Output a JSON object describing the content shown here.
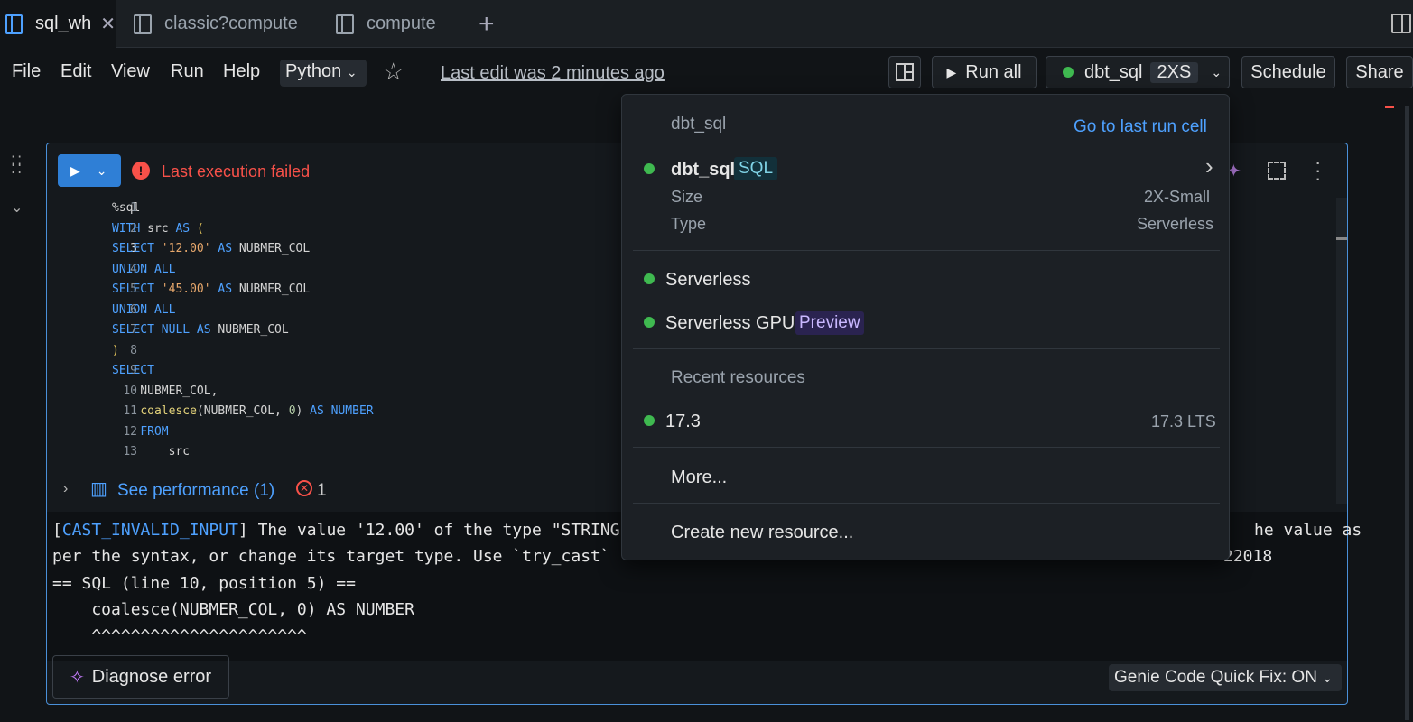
{
  "tabs": [
    {
      "label": "sql_wh",
      "active": true
    },
    {
      "label": "classic?compute",
      "active": false
    },
    {
      "label": "compute",
      "active": false
    }
  ],
  "menu": {
    "file": "File",
    "edit": "Edit",
    "view": "View",
    "run": "Run",
    "help": "Help",
    "language": "Python",
    "last_edit": "Last edit was 2 minutes ago"
  },
  "toolbar": {
    "run_all": "Run all",
    "compute_name": "dbt_sql",
    "compute_size": "2XS",
    "schedule": "Schedule",
    "share": "Share"
  },
  "cell": {
    "status": "Last execution failed",
    "code_lines": [
      {
        "n": "1",
        "text": "%sql"
      },
      {
        "n": "2",
        "text": "WITH src AS ("
      },
      {
        "n": "3",
        "text": "SELECT '12.00' AS NUBMER_COL"
      },
      {
        "n": "4",
        "text": "UNION ALL"
      },
      {
        "n": "5",
        "text": "SELECT '45.00' AS NUBMER_COL"
      },
      {
        "n": "6",
        "text": "UNION ALL"
      },
      {
        "n": "7",
        "text": "SELECT NULL AS NUBMER_COL"
      },
      {
        "n": "8",
        "text": ")"
      },
      {
        "n": "9",
        "text": "SELECT"
      },
      {
        "n": "10",
        "text": "    NUBMER_COL,"
      },
      {
        "n": "11",
        "text": "    coalesce(NUBMER_COL, 0) AS NUMBER"
      },
      {
        "n": "12",
        "text": "    FROM"
      },
      {
        "n": "13",
        "text": "        src"
      }
    ],
    "see_performance": "See performance (1)",
    "error_count": "1",
    "output": {
      "line1_prefix": "[",
      "line1_code": "CAST_INVALID_INPUT",
      "line1_rest": "] The value '12.00' of the type \"STRING",
      "line1_tail": "he value as",
      "line2": "per the syntax, or change its target type. Use `try_cast`",
      "line2_tail": "22018",
      "line3": "== SQL (line 10, position 5) ==",
      "line4": "    coalesce(NUBMER_COL, 0) AS NUMBER",
      "line5": "    ^^^^^^^^^^^^^^^^^^^^^^"
    },
    "diagnose": "Diagnose error",
    "genie": "Genie Code Quick Fix: ON"
  },
  "dropdown": {
    "header": "dbt_sql",
    "go_last": "Go to last run cell",
    "selected_name": "dbt_sql",
    "selected_badge": "SQL",
    "size_label": "Size",
    "size_value": "2X-Small",
    "type_label": "Type",
    "type_value": "Serverless",
    "serverless": "Serverless",
    "serverless_gpu": "Serverless GPU",
    "preview_badge": "Preview",
    "recent_header": "Recent resources",
    "recent_name": "17.3",
    "recent_value": "17.3 LTS",
    "more": "More...",
    "create": "Create new resource..."
  },
  "colors": {
    "accent": "#4ea1ff",
    "error": "#f85149",
    "success": "#3fb950",
    "background": "#111417"
  }
}
